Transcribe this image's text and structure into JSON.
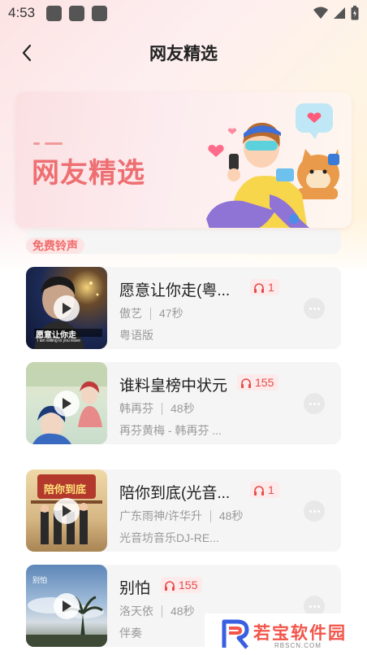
{
  "status_bar": {
    "time": "4:53"
  },
  "header": {
    "title": "网友精选"
  },
  "banner": {
    "title": "网友精选"
  },
  "partial_item": {
    "tag": "免费铃声"
  },
  "songs": [
    {
      "title": "愿意让你走(粤...",
      "listens": "1",
      "artist": "傲艺",
      "duration": "47秒",
      "album": "粤语版",
      "cover_text": "愿意让你走",
      "cover_subtext": "I am willing to you leave"
    },
    {
      "title": "谁料皇榜中状元",
      "listens": "155",
      "artist": "韩再芬",
      "duration": "48秒",
      "album": "再芬黄梅 - 韩再芬 ..."
    },
    {
      "title": "陪你到底(光音...",
      "listens": "1",
      "artist": "广东雨神/许华升",
      "duration": "48秒",
      "album": "光音坊音乐DJ-RE...",
      "cover_text": "陪你到底"
    },
    {
      "title": "别怕",
      "listens": "155",
      "artist": "洛天依",
      "duration": "48秒",
      "album": "伴奏",
      "cover_text": "别怕"
    }
  ],
  "watermark": {
    "text": "若宝软件园",
    "sub": "RBSCN.COM"
  },
  "colors": {
    "accent": "#e54b4b",
    "banner_title": "#ee6f72",
    "card_bg": "#f5f5f5"
  },
  "icons": {
    "back": "chevron-left-icon",
    "listen": "headphones-icon",
    "play": "play-icon",
    "more": "more-dots-icon"
  }
}
